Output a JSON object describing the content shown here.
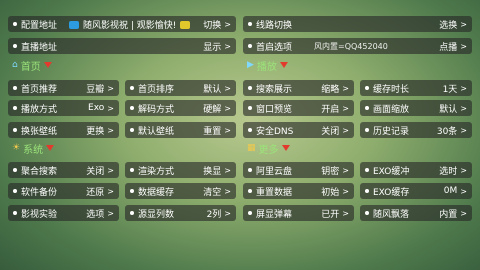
{
  "top": [
    {
      "label": "配置地址",
      "middle": "随风影视祝 | 观影愉快!",
      "value": "切换",
      "arrow": ">"
    },
    {
      "label": "线路切换",
      "value": "选换",
      "arrow": ">"
    },
    {
      "label": "直播地址",
      "value": "显示",
      "arrow": ">"
    },
    {
      "label": "首启选项",
      "middle": "风内置=QQ452040",
      "value": "点播",
      "arrow": ">"
    }
  ],
  "sections": [
    {
      "title": "首页",
      "items": [
        {
          "label": "首页推荐",
          "value": "豆瓣",
          "arrow": ">"
        },
        {
          "label": "首页排序",
          "value": "默认",
          "arrow": ">"
        },
        {
          "label": "播放方式",
          "value": "Exo",
          "arrow": ">"
        },
        {
          "label": "解码方式",
          "value": "硬解",
          "arrow": ">"
        },
        {
          "label": "换张壁纸",
          "value": "更换",
          "arrow": ">"
        },
        {
          "label": "默认壁纸",
          "value": "重置",
          "arrow": ">"
        }
      ]
    },
    {
      "title": "播放",
      "items": [
        {
          "label": "搜索展示",
          "value": "缩略",
          "arrow": ">"
        },
        {
          "label": "缓存时长",
          "value": "1天",
          "arrow": ">"
        },
        {
          "label": "窗口预览",
          "value": "开启",
          "arrow": ">"
        },
        {
          "label": "画面缩放",
          "value": "默认",
          "arrow": ">"
        },
        {
          "label": "安全DNS",
          "value": "关闭",
          "arrow": ">"
        },
        {
          "label": "历史记录",
          "value": "30条",
          "arrow": ">"
        }
      ]
    },
    {
      "title": "系统",
      "items": [
        {
          "label": "聚合搜索",
          "value": "关闭",
          "arrow": ">"
        },
        {
          "label": "渲染方式",
          "value": "换显",
          "arrow": ">"
        },
        {
          "label": "软件备份",
          "value": "还原",
          "arrow": ">"
        },
        {
          "label": "数据缓存",
          "value": "清空",
          "arrow": ">"
        },
        {
          "label": "影视实验",
          "value": "选项",
          "arrow": ">"
        },
        {
          "label": "源显列数",
          "value": "2列",
          "arrow": ">"
        }
      ]
    },
    {
      "title": "更多",
      "items": [
        {
          "label": "阿里云盘",
          "value": "钥密",
          "arrow": ">"
        },
        {
          "label": "EXO缓冲",
          "value": "选时",
          "arrow": ">"
        },
        {
          "label": "重置数据",
          "value": "初始",
          "arrow": ">"
        },
        {
          "label": "EXO缓存",
          "value": "0M",
          "arrow": ">"
        },
        {
          "label": "屏显弹幕",
          "value": "已开",
          "arrow": ">"
        },
        {
          "label": "随风飘落",
          "value": "内置",
          "arrow": ">"
        }
      ]
    }
  ]
}
